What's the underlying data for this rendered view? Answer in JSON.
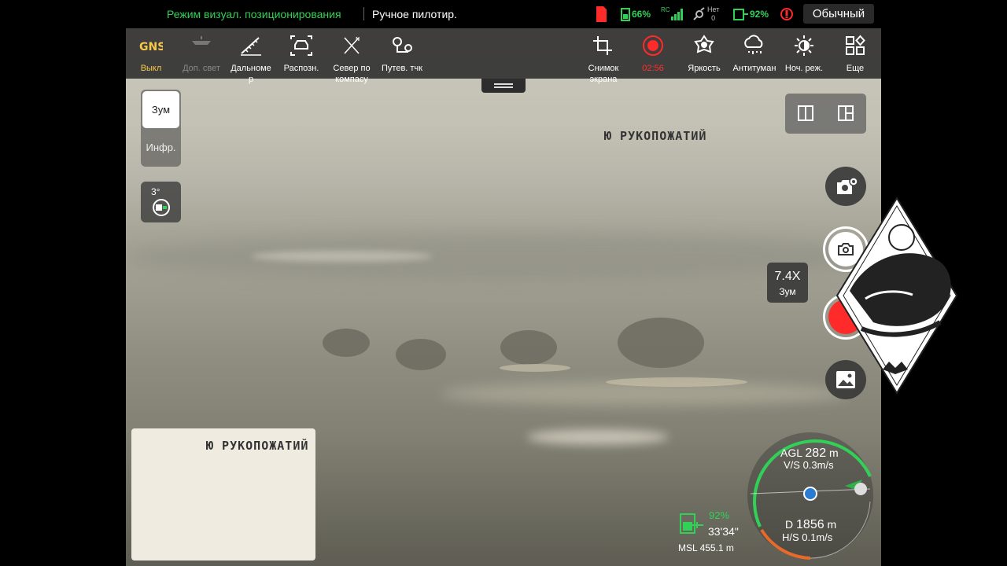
{
  "status": {
    "mode_label": "Режим визуал. позиционирования",
    "flight_label": "Ручное пилотир.",
    "rc_battery": "66%",
    "rc_label": "RC",
    "gps_label": "Нет",
    "gps_count": "0",
    "aircraft_battery": "92%",
    "profile": "Обычный"
  },
  "toolbar": {
    "gnss_label": "Выкл",
    "aux_light_label": "Доп. свет",
    "rangefinder_label": "Дальноме\nр",
    "detect_label": "Распозн.",
    "compass_label": "Север по\nкомпасу",
    "waypoint_label": "Путев. тчк",
    "screenshot_label": "Снимок\nэкрана",
    "record_time": "02:56",
    "brightness_label": "Яркость",
    "antifog_label": "Антитуман",
    "night_label": "Ноч. реж.",
    "more_label": "Еще"
  },
  "lens": {
    "zoom_label": "Зум",
    "ir_label": "Инфр."
  },
  "gimbal": {
    "pitch": "3°"
  },
  "zoom": {
    "value": "7.4X",
    "label": "Зум"
  },
  "watermark": {
    "text": "Ю РУКОПОЖАТИЙ"
  },
  "telemetry": {
    "agl_label": "AGL",
    "agl_value": "282",
    "agl_unit": "m",
    "vs": "V/S 0.3m/s",
    "dist_label": "D",
    "dist_value": "1856",
    "dist_unit": "m",
    "hs": "H/S 0.1m/s",
    "battery_pct": "92%",
    "flight_time": "33'34\"",
    "msl": "MSL 455.1 m"
  },
  "colors": {
    "accent_green": "#31d158",
    "record_red": "#ff2a2a",
    "gnss_yellow": "#f7c948"
  }
}
